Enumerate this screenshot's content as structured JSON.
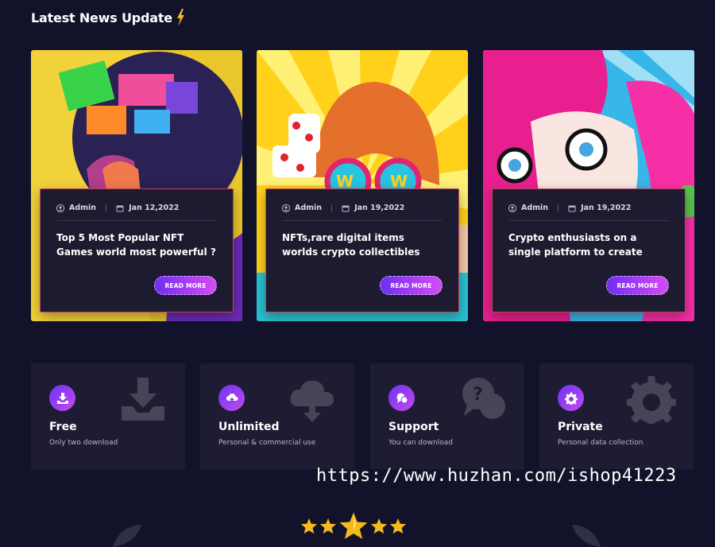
{
  "section": {
    "title": "Latest News Update",
    "title_icon": "lightning-bolt-icon",
    "accent": "#f5b91d"
  },
  "news": [
    {
      "author": "Admin",
      "date": "Jan 12,2022",
      "title": "Top 5 Most Popular NFT Games world most powerful ?",
      "cta": "READ MORE",
      "image": "pop-art-woman-side-profile-colorful-hair"
    },
    {
      "author": "Admin",
      "date": "Jan 19,2022",
      "title": "NFTs,rare digital items worlds crypto collectibles",
      "cta": "READ MORE",
      "image": "pop-art-woman-wow-glasses"
    },
    {
      "author": "Admin",
      "date": "Jan 19,2022",
      "title": "Crypto enthusiasts on a single platform to create",
      "cta": "READ MORE",
      "image": "pop-art-woman-pink-hair-glasses"
    }
  ],
  "features": [
    {
      "title": "Free",
      "subtitle": "Only two download",
      "icon": "download-tray-icon"
    },
    {
      "title": "Unlimited",
      "subtitle": "Personal & commercial use",
      "icon": "cloud-upload-icon"
    },
    {
      "title": "Support",
      "subtitle": "You can download",
      "icon": "chat-question-icon"
    },
    {
      "title": "Private",
      "subtitle": "Personal data collection",
      "icon": "gear-icon"
    }
  ],
  "watermark": "https://www.huzhan.com/ishop41223",
  "rating": {
    "stars": 5,
    "icon": "star-icon"
  },
  "colors": {
    "background": "#12132b",
    "card": "#1d1b2f",
    "card_border": "#c2445a",
    "gradient_start": "#6f2ff0",
    "gradient_end": "#d44cf2"
  }
}
